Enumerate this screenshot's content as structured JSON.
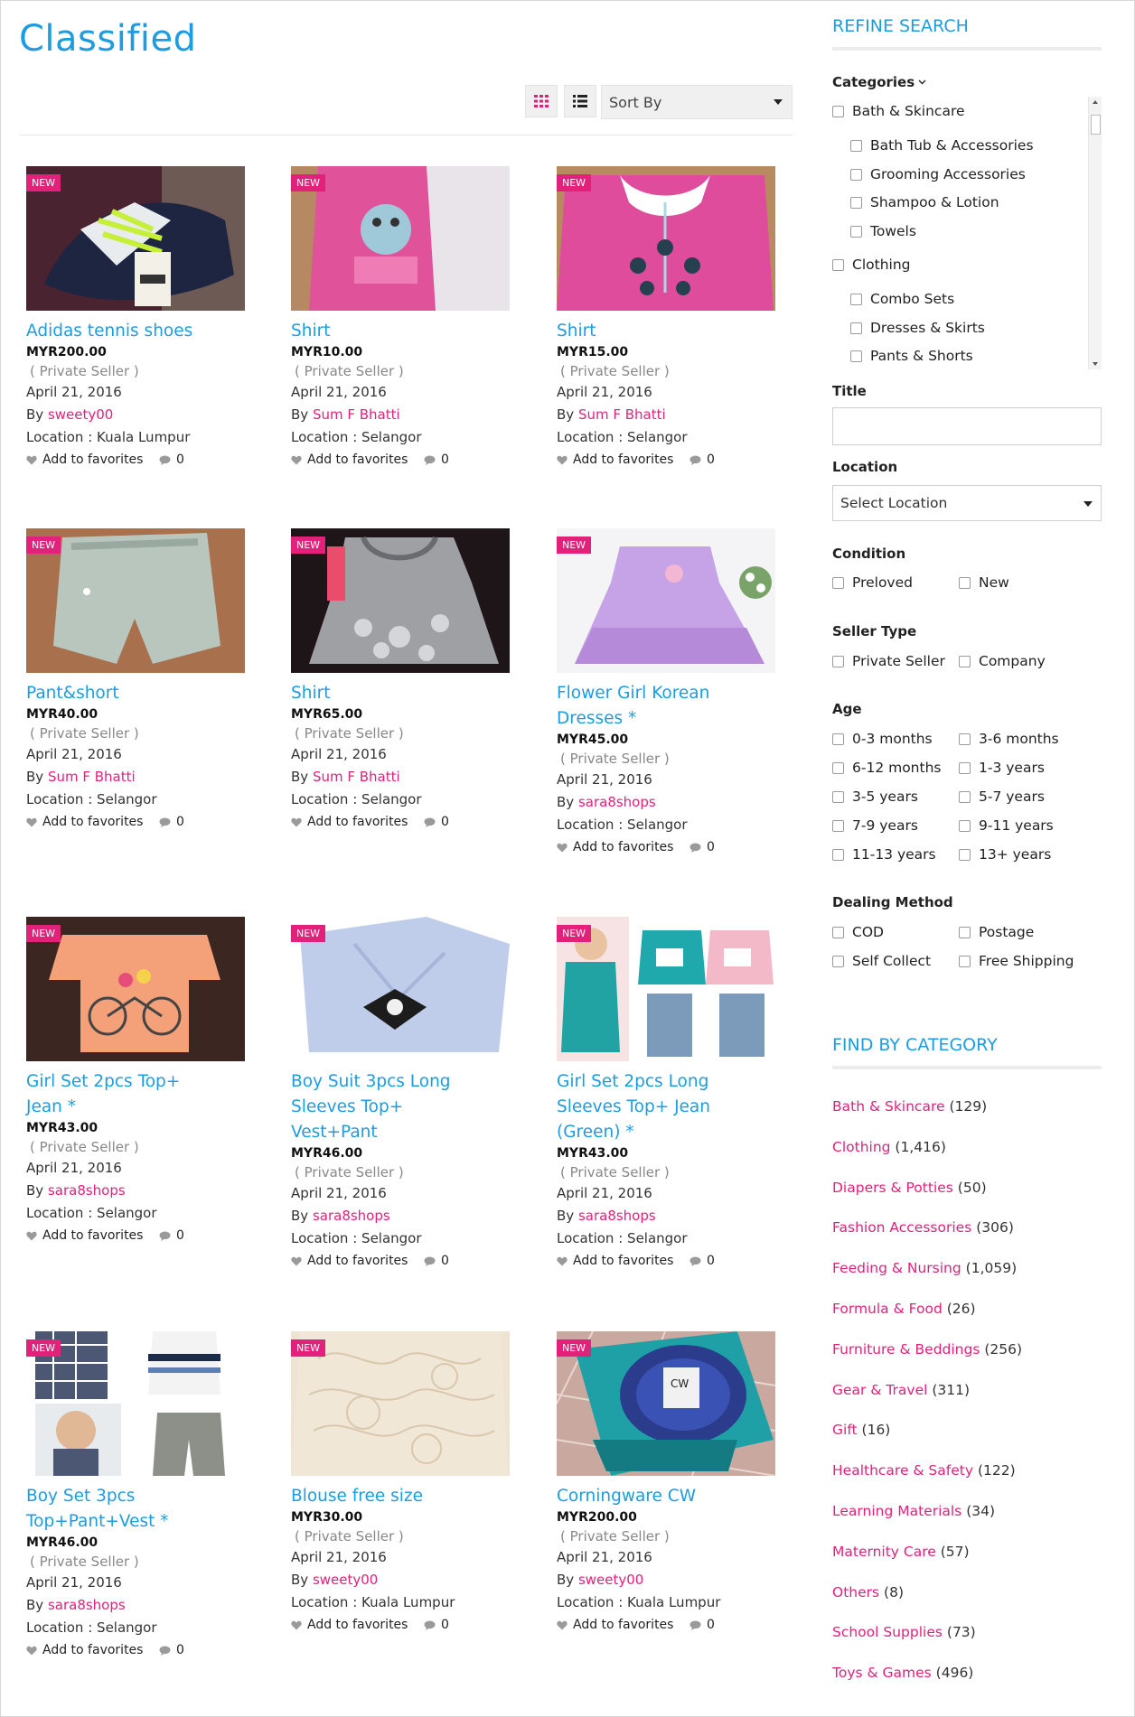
{
  "page_title": "Classified",
  "toolbar": {
    "sort_label": "Sort By"
  },
  "colors": {
    "accent": "#1e9ce1",
    "brand_pink": "#e2227a"
  },
  "listings": [
    {
      "badge": "NEW",
      "title_lines": [
        "Adidas tennis shoes"
      ],
      "price": "MYR200.00",
      "seller_type": "( Private Seller )",
      "date": "April 21, 2016",
      "by": "By",
      "seller": "sweety00",
      "location_label": "Location :",
      "location": "Kuala Lumpur",
      "fav": "Add to favorites",
      "comments": "0"
    },
    {
      "badge": "NEW",
      "title_lines": [
        "Shirt"
      ],
      "price": "MYR10.00",
      "seller_type": "( Private Seller )",
      "date": "April 21, 2016",
      "by": "By",
      "seller": "Sum F Bhatti",
      "location_label": "Location :",
      "location": "Selangor",
      "fav": "Add to favorites",
      "comments": "0"
    },
    {
      "badge": "NEW",
      "title_lines": [
        "Shirt"
      ],
      "price": "MYR15.00",
      "seller_type": "( Private Seller )",
      "date": "April 21, 2016",
      "by": "By",
      "seller": "Sum F Bhatti",
      "location_label": "Location :",
      "location": "Selangor",
      "fav": "Add to favorites",
      "comments": "0"
    },
    {
      "badge": "NEW",
      "title_lines": [
        "Pant&short"
      ],
      "price": "MYR40.00",
      "seller_type": "( Private Seller )",
      "date": "April 21, 2016",
      "by": "By",
      "seller": "Sum F Bhatti",
      "location_label": "Location :",
      "location": "Selangor",
      "fav": "Add to favorites",
      "comments": "0"
    },
    {
      "badge": "NEW",
      "title_lines": [
        "Shirt"
      ],
      "price": "MYR65.00",
      "seller_type": "( Private Seller )",
      "date": "April 21, 2016",
      "by": "By",
      "seller": "Sum F Bhatti",
      "location_label": "Location :",
      "location": "Selangor",
      "fav": "Add to favorites",
      "comments": "0"
    },
    {
      "badge": "NEW",
      "title_lines": [
        "Flower Girl Korean",
        "Dresses *"
      ],
      "price": "MYR45.00",
      "seller_type": "( Private Seller )",
      "date": "April 21, 2016",
      "by": "By",
      "seller": "sara8shops",
      "location_label": "Location :",
      "location": "Selangor",
      "fav": "Add to favorites",
      "comments": "0"
    },
    {
      "badge": "NEW",
      "title_lines": [
        "Girl Set 2pcs Top+",
        "Jean *"
      ],
      "price": "MYR43.00",
      "seller_type": "( Private Seller )",
      "date": "April 21, 2016",
      "by": "By",
      "seller": "sara8shops",
      "location_label": "Location :",
      "location": "Selangor",
      "fav": "Add to favorites",
      "comments": "0"
    },
    {
      "badge": "NEW",
      "title_lines": [
        "Boy Suit 3pcs Long",
        "Sleeves Top+",
        "Vest+Pant"
      ],
      "price": "MYR46.00",
      "seller_type": "( Private Seller )",
      "date": "April 21, 2016",
      "by": "By",
      "seller": "sara8shops",
      "location_label": "Location :",
      "location": "Selangor",
      "fav": "Add to favorites",
      "comments": "0"
    },
    {
      "badge": "NEW",
      "title_lines": [
        "Girl Set 2pcs Long",
        "Sleeves Top+ Jean",
        "(Green) *"
      ],
      "price": "MYR43.00",
      "seller_type": "( Private Seller )",
      "date": "April 21, 2016",
      "by": "By",
      "seller": "sara8shops",
      "location_label": "Location :",
      "location": "Selangor",
      "fav": "Add to favorites",
      "comments": "0"
    },
    {
      "badge": "NEW",
      "title_lines": [
        "Boy Set 3pcs",
        "Top+Pant+Vest *"
      ],
      "price": "MYR46.00",
      "seller_type": "( Private Seller )",
      "date": "April 21, 2016",
      "by": "By",
      "seller": "sara8shops",
      "location_label": "Location :",
      "location": "Selangor",
      "fav": "Add to favorites",
      "comments": "0"
    },
    {
      "badge": "NEW",
      "title_lines": [
        "Blouse free size"
      ],
      "price": "MYR30.00",
      "seller_type": "( Private Seller )",
      "date": "April 21, 2016",
      "by": "By",
      "seller": "sweety00",
      "location_label": "Location :",
      "location": "Kuala Lumpur",
      "fav": "Add to favorites",
      "comments": "0"
    },
    {
      "badge": "NEW",
      "title_lines": [
        "Corningware CW"
      ],
      "price": "MYR200.00",
      "seller_type": "( Private Seller )",
      "date": "April 21, 2016",
      "by": "By",
      "seller": "sweety00",
      "location_label": "Location :",
      "location": "Kuala Lumpur",
      "fav": "Add to favorites",
      "comments": "0"
    }
  ],
  "sidebar": {
    "refine_heading": "REFINE SEARCH",
    "categories_label": "Categories",
    "categories": [
      {
        "label": "Bath & Skincare",
        "level": 0
      },
      {
        "label": "Bath Tub & Accessories",
        "level": 1
      },
      {
        "label": "Grooming Accessories",
        "level": 1
      },
      {
        "label": "Shampoo & Lotion",
        "level": 1
      },
      {
        "label": "Towels",
        "level": 1
      },
      {
        "label": "Clothing",
        "level": 0
      },
      {
        "label": "Combo Sets",
        "level": 1
      },
      {
        "label": "Dresses & Skirts",
        "level": 1
      },
      {
        "label": "Pants & Shorts",
        "level": 1
      }
    ],
    "title_label": "Title",
    "title_value": "",
    "location_label": "Location",
    "location_selected": "Select Location",
    "condition_label": "Condition",
    "condition_options": [
      "Preloved",
      "New"
    ],
    "seller_type_label": "Seller Type",
    "seller_type_options": [
      "Private Seller",
      "Company"
    ],
    "age_label": "Age",
    "age_options": [
      "0-3 months",
      "3-6 months",
      "6-12 months",
      "1-3 years",
      "3-5 years",
      "5-7 years",
      "7-9 years",
      "9-11 years",
      "11-13 years",
      "13+ years"
    ],
    "dealing_label": "Dealing Method",
    "dealing_options": [
      "COD",
      "Postage",
      "Self Collect",
      "Free Shipping"
    ],
    "find_heading": "FIND BY CATEGORY",
    "find_categories": [
      {
        "name": "Bath & Skincare",
        "count": "(129)"
      },
      {
        "name": "Clothing",
        "count": "(1,416)"
      },
      {
        "name": "Diapers & Potties",
        "count": "(50)"
      },
      {
        "name": "Fashion Accessories",
        "count": "(306)"
      },
      {
        "name": "Feeding & Nursing",
        "count": "(1,059)"
      },
      {
        "name": "Formula & Food",
        "count": "(26)"
      },
      {
        "name": "Furniture & Beddings",
        "count": "(256)"
      },
      {
        "name": "Gear & Travel",
        "count": "(311)"
      },
      {
        "name": "Gift",
        "count": "(16)"
      },
      {
        "name": "Healthcare & Safety",
        "count": "(122)"
      },
      {
        "name": "Learning Materials",
        "count": "(34)"
      },
      {
        "name": "Maternity Care",
        "count": "(57)"
      },
      {
        "name": "Others",
        "count": "(8)"
      },
      {
        "name": "School Supplies",
        "count": "(73)"
      },
      {
        "name": "Toys & Games",
        "count": "(496)"
      }
    ]
  }
}
